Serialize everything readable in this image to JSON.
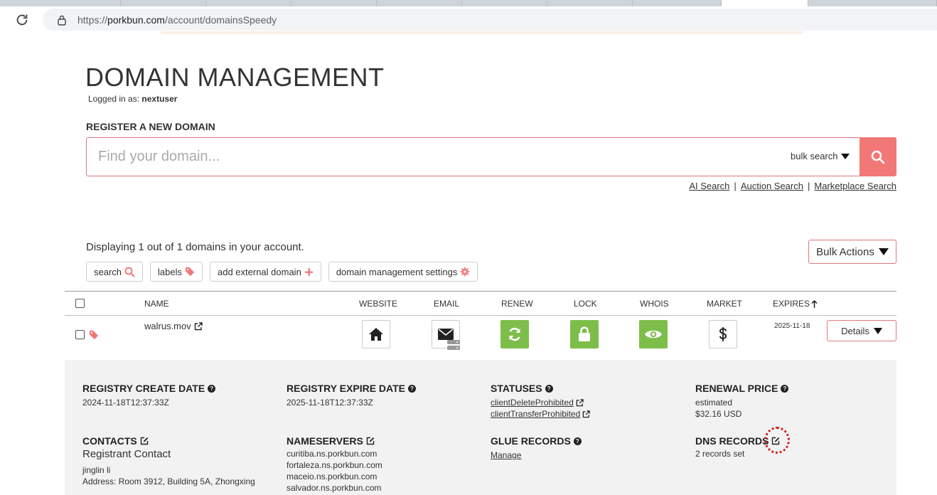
{
  "browser": {
    "url_prefix": "https://",
    "url_host": "porkbun.com",
    "url_path": "/account/domainsSpeedy"
  },
  "header": {
    "title": "DOMAIN MANAGEMENT",
    "logged_in_prefix": "Logged in as:",
    "username": "nextuser"
  },
  "register": {
    "label": "REGISTER A NEW DOMAIN",
    "placeholder": "Find your domain...",
    "bulk_search": "bulk search",
    "links": [
      "AI Search",
      "Auction Search",
      "Marketplace Search"
    ]
  },
  "listing": {
    "count_text": "Displaying 1 out of 1 domains in your account.",
    "bulk_actions": "Bulk Actions",
    "filters": {
      "search": "search",
      "labels": "labels",
      "add_external": "add external domain",
      "settings": "domain management settings"
    }
  },
  "table": {
    "headers": {
      "name": "NAME",
      "website": "WEBSITE",
      "email": "EMAIL",
      "renew": "RENEW",
      "lock": "LOCK",
      "whois": "WHOIS",
      "market": "MARKET",
      "expires": "EXPIRES"
    },
    "row": {
      "domain": "walrus.mov",
      "expires": "2025-11-18",
      "details": "Details"
    }
  },
  "details": {
    "registry_create_label": "REGISTRY CREATE DATE",
    "registry_create_value": "2024-11-18T12:37:33Z",
    "registry_expire_label": "REGISTRY EXPIRE DATE",
    "registry_expire_value": "2025-11-18T12:37:33Z",
    "statuses_label": "STATUSES",
    "status_1": "clientDeleteProhibited",
    "status_2": "clientTransferProhibited",
    "renewal_label": "RENEWAL PRICE",
    "renewal_note": "estimated",
    "renewal_value": "$32.16 USD",
    "contacts_label": "CONTACTS",
    "registrant_label": "Registrant Contact",
    "contact_name": "jinglin li",
    "contact_address": "Address: Room 3912, Building 5A, Zhongxing",
    "nameservers_label": "NAMESERVERS",
    "nameservers": [
      "curitiba.ns.porkbun.com",
      "fortaleza.ns.porkbun.com",
      "maceio.ns.porkbun.com",
      "salvador.ns.porkbun.com"
    ],
    "glue_label": "GLUE RECORDS",
    "glue_link": "Manage",
    "dns_label": "DNS RECORDS",
    "dns_value": "2 records set"
  },
  "colors": {
    "accent": "#f27777",
    "green": "#7dbe4b",
    "panel_bg": "#f2f2f2"
  }
}
